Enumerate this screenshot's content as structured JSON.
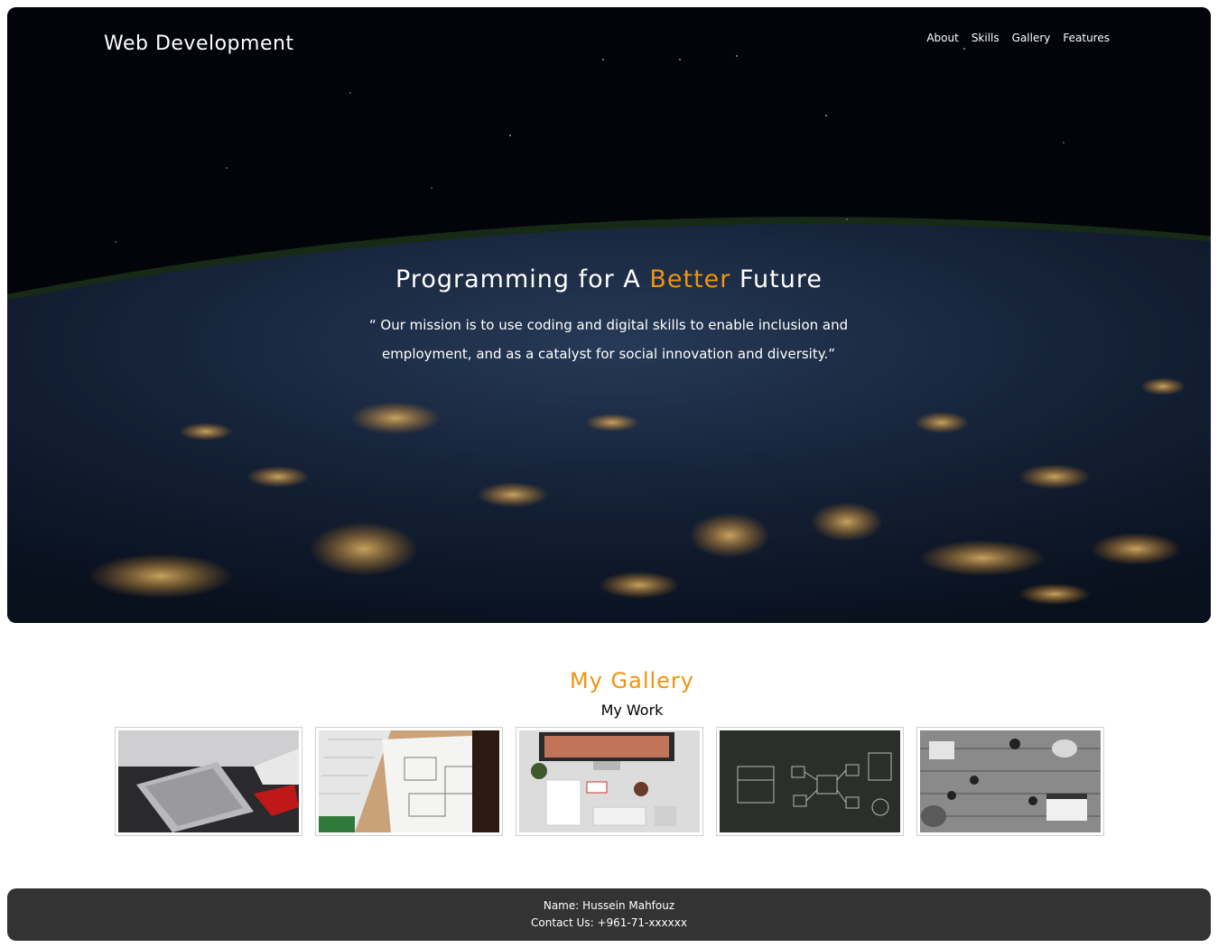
{
  "header": {
    "brand": "Web Development",
    "nav": [
      "About",
      "Skills",
      "Gallery",
      "Features"
    ]
  },
  "hero": {
    "title_pre": "Programming for A ",
    "title_accent": "Better",
    "title_post": " Future",
    "quote": "“ Our mission is to use coding and digital skills to enable inclusion and employment, and as a catalyst for social innovation and diversity.”"
  },
  "gallery": {
    "title": "My Gallery",
    "subtitle": "My Work",
    "images": [
      "laptop-desk-photo",
      "keyboard-sketch-photo",
      "imac-desk-photo",
      "chalkboard-diagram-photo",
      "team-meeting-photo"
    ]
  },
  "footer": {
    "name_line": "Name: Hussein Mahfouz",
    "contact_line": "Contact Us: +961-71-xxxxxx"
  },
  "colors": {
    "accent": "#f0930f",
    "footer_bg": "#333333",
    "text": "#ffffff"
  }
}
